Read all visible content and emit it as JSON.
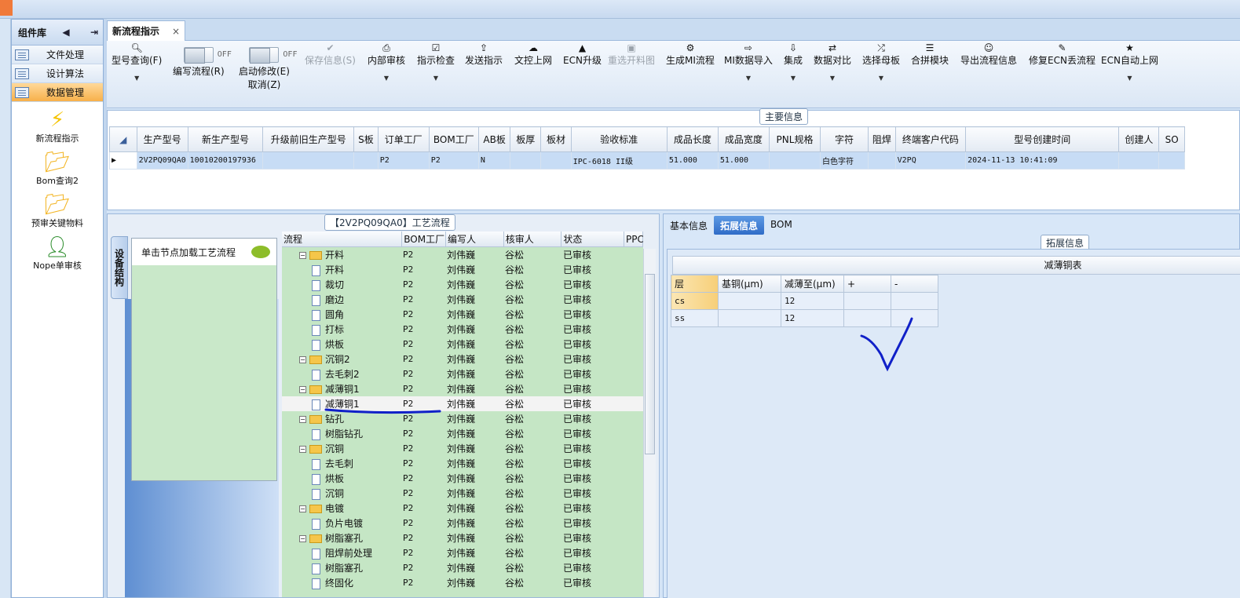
{
  "sidebar": {
    "title": "组件库",
    "nav": [
      "文件处理",
      "设计算法",
      "数据管理"
    ],
    "active_nav": 2,
    "tools": [
      "新流程指示",
      "Bom查询2",
      "预审关键物料",
      "Nope单审核"
    ]
  },
  "tab": {
    "label": "新流程指示",
    "close": "×"
  },
  "toolbar": {
    "model_query": "型号查询(F)",
    "edit_flow": "编写流程(R)",
    "auto_modify": "启动修改(E)",
    "cancel": "取消(Z)",
    "toggle_off": "OFF",
    "save": "保存信息(S)",
    "internal_review": "内部审核",
    "check": "指示检查",
    "send": "发送指示",
    "upload_doc": "文控上网",
    "ecn_upgrade": "ECN升级",
    "reselect_cut": "重选开料图",
    "gen_mi": "生成MI流程",
    "mi_import": "MI数据导入",
    "integrate": "集成",
    "compare": "数据对比",
    "select_master": "选择母板",
    "merge_module": "合拼模块",
    "export_flow": "导出流程信息",
    "fix_ecn": "修复ECN丢流程",
    "ecn_auto": "ECN自动上网"
  },
  "main_info": {
    "legend": "主要信息",
    "columns": [
      "生产型号",
      "新生产型号",
      "升级前旧生产型号",
      "S板",
      "订单工厂",
      "BOM工厂",
      "AB板",
      "板厚",
      "板材",
      "验收标准",
      "成品长度",
      "成品宽度",
      "PNL规格",
      "字符",
      "阻焊",
      "终端客户代码",
      "型号创建时间",
      "创建人",
      "SO"
    ],
    "row": [
      "2V2PQ09QA0",
      "10010200197936",
      "",
      "",
      "P2",
      "P2",
      "N",
      "",
      "",
      "IPC-6018 II级",
      "51.000",
      "51.000",
      "",
      "白色字符",
      "",
      "V2PQ",
      "2024-11-13 10:41:09",
      "",
      ""
    ]
  },
  "flow": {
    "legend": "【2V2PQ09QA0】工艺流程",
    "side_tab": "设备结构",
    "click_hint": "单击节点加载工艺流程",
    "columns": [
      "流程",
      "BOM工厂",
      "编写人",
      "核审人",
      "状态",
      "PPC"
    ],
    "rows": [
      {
        "level": 0,
        "name": "开料",
        "bom": "P2",
        "writer": "刘伟巍",
        "checker": "谷松",
        "status": "已审核"
      },
      {
        "level": 1,
        "name": "开料",
        "bom": "P2",
        "writer": "刘伟巍",
        "checker": "谷松",
        "status": "已审核"
      },
      {
        "level": 1,
        "name": "裁切",
        "bom": "P2",
        "writer": "刘伟巍",
        "checker": "谷松",
        "status": "已审核"
      },
      {
        "level": 1,
        "name": "磨边",
        "bom": "P2",
        "writer": "刘伟巍",
        "checker": "谷松",
        "status": "已审核"
      },
      {
        "level": 1,
        "name": "圆角",
        "bom": "P2",
        "writer": "刘伟巍",
        "checker": "谷松",
        "status": "已审核"
      },
      {
        "level": 1,
        "name": "打标",
        "bom": "P2",
        "writer": "刘伟巍",
        "checker": "谷松",
        "status": "已审核"
      },
      {
        "level": 1,
        "name": "烘板",
        "bom": "P2",
        "writer": "刘伟巍",
        "checker": "谷松",
        "status": "已审核"
      },
      {
        "level": 0,
        "name": "沉铜2",
        "bom": "P2",
        "writer": "刘伟巍",
        "checker": "谷松",
        "status": "已审核"
      },
      {
        "level": 1,
        "name": "去毛刺2",
        "bom": "P2",
        "writer": "刘伟巍",
        "checker": "谷松",
        "status": "已审核"
      },
      {
        "level": 0,
        "name": "减薄铜1",
        "bom": "P2",
        "writer": "刘伟巍",
        "checker": "谷松",
        "status": "已审核"
      },
      {
        "level": 1,
        "name": "减薄铜1",
        "bom": "P2",
        "writer": "刘伟巍",
        "checker": "谷松",
        "status": "已审核",
        "selected": true
      },
      {
        "level": 0,
        "name": "钻孔",
        "bom": "P2",
        "writer": "刘伟巍",
        "checker": "谷松",
        "status": "已审核"
      },
      {
        "level": 1,
        "name": "树脂钻孔",
        "bom": "P2",
        "writer": "刘伟巍",
        "checker": "谷松",
        "status": "已审核"
      },
      {
        "level": 0,
        "name": "沉铜",
        "bom": "P2",
        "writer": "刘伟巍",
        "checker": "谷松",
        "status": "已审核"
      },
      {
        "level": 1,
        "name": "去毛刺",
        "bom": "P2",
        "writer": "刘伟巍",
        "checker": "谷松",
        "status": "已审核"
      },
      {
        "level": 1,
        "name": "烘板",
        "bom": "P2",
        "writer": "刘伟巍",
        "checker": "谷松",
        "status": "已审核"
      },
      {
        "level": 1,
        "name": "沉铜",
        "bom": "P2",
        "writer": "刘伟巍",
        "checker": "谷松",
        "status": "已审核"
      },
      {
        "level": 0,
        "name": "电镀",
        "bom": "P2",
        "writer": "刘伟巍",
        "checker": "谷松",
        "status": "已审核"
      },
      {
        "level": 1,
        "name": "负片电镀",
        "bom": "P2",
        "writer": "刘伟巍",
        "checker": "谷松",
        "status": "已审核"
      },
      {
        "level": 0,
        "name": "树脂塞孔",
        "bom": "P2",
        "writer": "刘伟巍",
        "checker": "谷松",
        "status": "已审核"
      },
      {
        "level": 1,
        "name": "阻焊前处理",
        "bom": "P2",
        "writer": "刘伟巍",
        "checker": "谷松",
        "status": "已审核"
      },
      {
        "level": 1,
        "name": "树脂塞孔",
        "bom": "P2",
        "writer": "刘伟巍",
        "checker": "谷松",
        "status": "已审核"
      },
      {
        "level": 1,
        "name": "终固化",
        "bom": "P2",
        "writer": "刘伟巍",
        "checker": "谷松",
        "status": "已审核"
      }
    ]
  },
  "right": {
    "tabs": [
      "基本信息",
      "拓展信息",
      "BOM"
    ],
    "active_tab": 1,
    "legend": "拓展信息",
    "table_title": "减薄铜表",
    "columns": [
      "层",
      "基铜(μm)",
      "减薄至(μm)",
      "+",
      "-"
    ],
    "rows": [
      [
        "cs",
        "",
        "12",
        "",
        ""
      ],
      [
        "ss",
        "",
        "12",
        "",
        ""
      ]
    ]
  },
  "colors": {
    "accent": "#2f6cc7",
    "tree_bg": "#c5e6c5",
    "ink": "#1020c8"
  }
}
